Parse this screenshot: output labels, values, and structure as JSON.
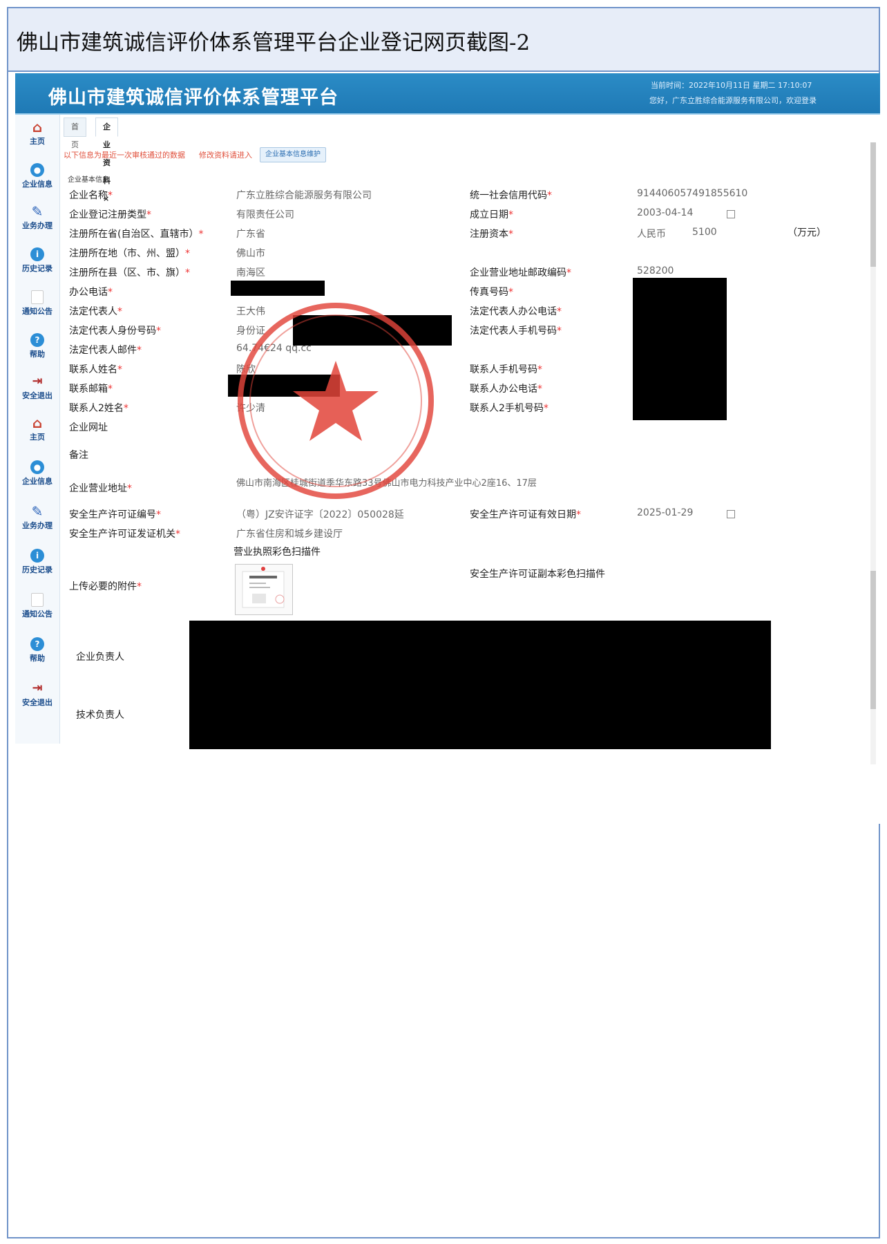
{
  "document_title": "佛山市建筑诚信评价体系管理平台企业登记网页截图-2",
  "banner": {
    "system_name": "佛山市建筑诚信评价体系管理平台",
    "info_line1": "当前时间：2022年10月11日 星期二 17:10:07",
    "info_line2": "您好，广东立胜综合能源服务有限公司，欢迎登录"
  },
  "sidebar": [
    {
      "label": "主页",
      "icon": "home-icon"
    },
    {
      "label": "企业信息",
      "icon": "info-icon"
    },
    {
      "label": "业务办理",
      "icon": "pen-icon"
    },
    {
      "label": "历史记录",
      "icon": "history-icon"
    },
    {
      "label": "通知公告",
      "icon": "notice-icon"
    },
    {
      "label": "帮助",
      "icon": "help-icon"
    },
    {
      "label": "安全退出",
      "icon": "exit-icon"
    },
    {
      "label": "主页",
      "icon": "home-icon"
    },
    {
      "label": "企业信息",
      "icon": "info-icon"
    },
    {
      "label": "业务办理",
      "icon": "pen-icon"
    },
    {
      "label": "历史记录",
      "icon": "history-icon"
    },
    {
      "label": "通知公告",
      "icon": "notice-icon"
    },
    {
      "label": "帮助",
      "icon": "help-icon"
    },
    {
      "label": "安全退出",
      "icon": "exit-icon"
    }
  ],
  "tabs": [
    {
      "label": "首页"
    },
    {
      "label": "企业资料 ×"
    }
  ],
  "notes": {
    "latest": "以下信息为最近一次审核通过的数据",
    "modify": "修改资料请进入",
    "button": "企业基本信息维护"
  },
  "section_title": "企业基本信息",
  "fields_left": [
    {
      "label": "企业名称",
      "req": "*",
      "value": "广东立胜综合能源服务有限公司"
    },
    {
      "label": "企业登记注册类型",
      "req": "*",
      "value": "有限责任公司"
    },
    {
      "label": "注册所在省(自治区、直辖市）",
      "req": "*",
      "value": "广东省"
    },
    {
      "label": "注册所在地（市、州、盟）",
      "req": "*",
      "value": "佛山市"
    },
    {
      "label": "注册所在县（区、市、旗）",
      "req": "*",
      "value": "南海区"
    },
    {
      "label": "办公电话",
      "req": "*",
      "value": ""
    },
    {
      "label": "法定代表人",
      "req": "*",
      "value": "王大伟"
    },
    {
      "label": "法定代表人身份号码",
      "req": "*",
      "value": "身份证"
    },
    {
      "label": "法定代表人邮件",
      "req": "*",
      "value": "64.74€24 qq.cc"
    },
    {
      "label": "联系人姓名",
      "req": "*",
      "value": "陈欣"
    },
    {
      "label": "联系邮箱",
      "req": "*",
      "value": ""
    },
    {
      "label": "联系人2姓名",
      "req": "*",
      "value": "许少清"
    },
    {
      "label": "企业网址",
      "req": "",
      "value": ""
    },
    {
      "label": "备注",
      "req": "",
      "value": ""
    }
  ],
  "fields_right": [
    {
      "label": "统一社会信用代码",
      "req": "*",
      "value": "914406057491855610"
    },
    {
      "label": "成立日期",
      "req": "*",
      "value": "2003-04-14"
    },
    {
      "label": "注册资本",
      "req": "*",
      "value": "人民币",
      "amount": "5100",
      "unit": "（万元）"
    },
    {
      "label": "企业营业地址邮政编码",
      "req": "*",
      "value": "528200"
    },
    {
      "label": "传真号码",
      "req": "*",
      "value": ""
    },
    {
      "label": "法定代表人办公电话",
      "req": "*",
      "value": ""
    },
    {
      "label": "法定代表人手机号码",
      "req": "*",
      "value": ""
    },
    {
      "label": "联系人手机号码",
      "req": "*",
      "value": ""
    },
    {
      "label": "联系人办公电话",
      "req": "*",
      "value": ""
    },
    {
      "label": "联系人2手机号码",
      "req": "*",
      "value": ""
    }
  ],
  "address": {
    "label": "企业营业地址",
    "req": "*",
    "value": "佛山市南海区桂城街道季华东路33号佛山市电力科技产业中心2座16、17层"
  },
  "safety": {
    "license_no_label": "安全生产许可证编号",
    "license_no_req": "*",
    "license_no": "（粤）JZ安许证字〔2022〕050028延",
    "license_org_label": "安全生产许可证发证机关",
    "license_org_req": "*",
    "license_org": "广东省住房和城乡建设厅",
    "license_date_label": "安全生产许可证有效日期",
    "license_date_req": "*",
    "license_date": "2025-01-29"
  },
  "attachments": {
    "label": "上传必要的附件",
    "req": "*",
    "business_license": "营业执照彩色扫描件",
    "safety_copy": "安全生产许可证副本彩色扫描件"
  },
  "people": {
    "enterprise_head": "企业负责人",
    "tech_head": "技术负责人"
  },
  "colors": {
    "banner": "#1f79b5",
    "required": "#e33333",
    "stamp": "#e2443a",
    "sidebar_text": "#1b4d8c"
  }
}
